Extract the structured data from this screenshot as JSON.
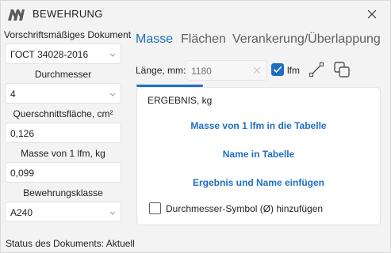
{
  "window": {
    "title": "BEWEHRUNG",
    "close_icon": "close-icon",
    "logo_icon": "app-logo-icon",
    "accent_color": "#1f6fc0"
  },
  "left_panel": {
    "document": {
      "label": "Vorschriftsmäßiges Dokument",
      "value": "ГОСТ 34028-2016"
    },
    "diameter": {
      "label": "Durchmesser",
      "value": "4"
    },
    "area": {
      "label": "Querschnittsfläche, cm²",
      "value": "0,126"
    },
    "mass": {
      "label": "Masse von 1 lfm, kg",
      "value": "0,099"
    },
    "rebar_class": {
      "label": "Bewehrungsklasse",
      "value": "A240"
    }
  },
  "tabs": [
    {
      "label": "Masse",
      "active": true
    },
    {
      "label": "Flächen",
      "active": false
    },
    {
      "label": "Verankerung/Überlappung",
      "active": false
    }
  ],
  "length": {
    "label": "Länge, mm:",
    "placeholder": "1180",
    "lfm_checked": true,
    "lfm_label": "lfm",
    "diagonal_icon": "diagonal-arrows-icon",
    "copy_icon": "copy-icon"
  },
  "result": {
    "title": "ERGEBNIS, kg",
    "action_mass": "Masse von 1 lfm in die Tabelle",
    "action_name": "Name in Tabelle",
    "action_both": "Ergebnis und Name einfügen",
    "diameter_symbol_label": "Durchmesser-Symbol (Ø) hinzufügen",
    "diameter_symbol_checked": false
  },
  "status": "Status des Dokuments: Aktuell"
}
